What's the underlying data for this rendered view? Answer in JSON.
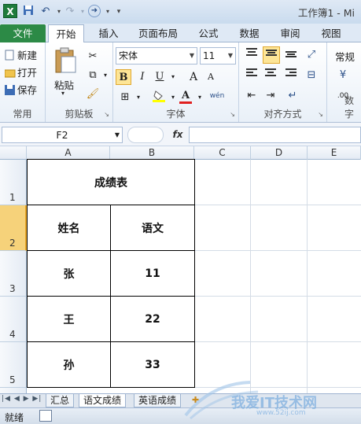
{
  "window": {
    "app_icon": "X",
    "title": "工作簿1 - Mi"
  },
  "quick_access": {
    "save": "save-icon",
    "undo": "undo-icon",
    "redo": "redo-icon",
    "forward": "forward-icon"
  },
  "tabs": [
    "文件",
    "开始",
    "插入",
    "页面布局",
    "公式",
    "数据",
    "审阅",
    "视图"
  ],
  "ribbon": {
    "common": {
      "new": "新建",
      "open": "打开",
      "save": "保存",
      "label": "常用"
    },
    "clipboard": {
      "paste": "粘贴",
      "label": "剪贴板"
    },
    "font": {
      "name": "宋体",
      "size": "11",
      "bold": "B",
      "italic": "I",
      "underline": "U",
      "grow": "A",
      "shrink": "A",
      "phonetic": "wén",
      "label": "字体"
    },
    "alignment": {
      "label": "对齐方式"
    },
    "number": {
      "format": "常规",
      "label": "数字"
    }
  },
  "formula_bar": {
    "cell_ref": "F2",
    "fx": "fx",
    "value": ""
  },
  "columns": [
    "A",
    "B",
    "C",
    "D",
    "E"
  ],
  "rows": [
    "1",
    "2",
    "3",
    "4",
    "5"
  ],
  "table": {
    "title": "成绩表",
    "headers": [
      "姓名",
      "语文"
    ],
    "rows": [
      [
        "张",
        "11"
      ],
      [
        "王",
        "22"
      ],
      [
        "孙",
        "33"
      ]
    ]
  },
  "sheets": [
    "汇总",
    "语文成绩",
    "英语成绩"
  ],
  "status": {
    "ready": "就绪"
  },
  "watermark": "我爱IT技术网 www.52ij.com"
}
